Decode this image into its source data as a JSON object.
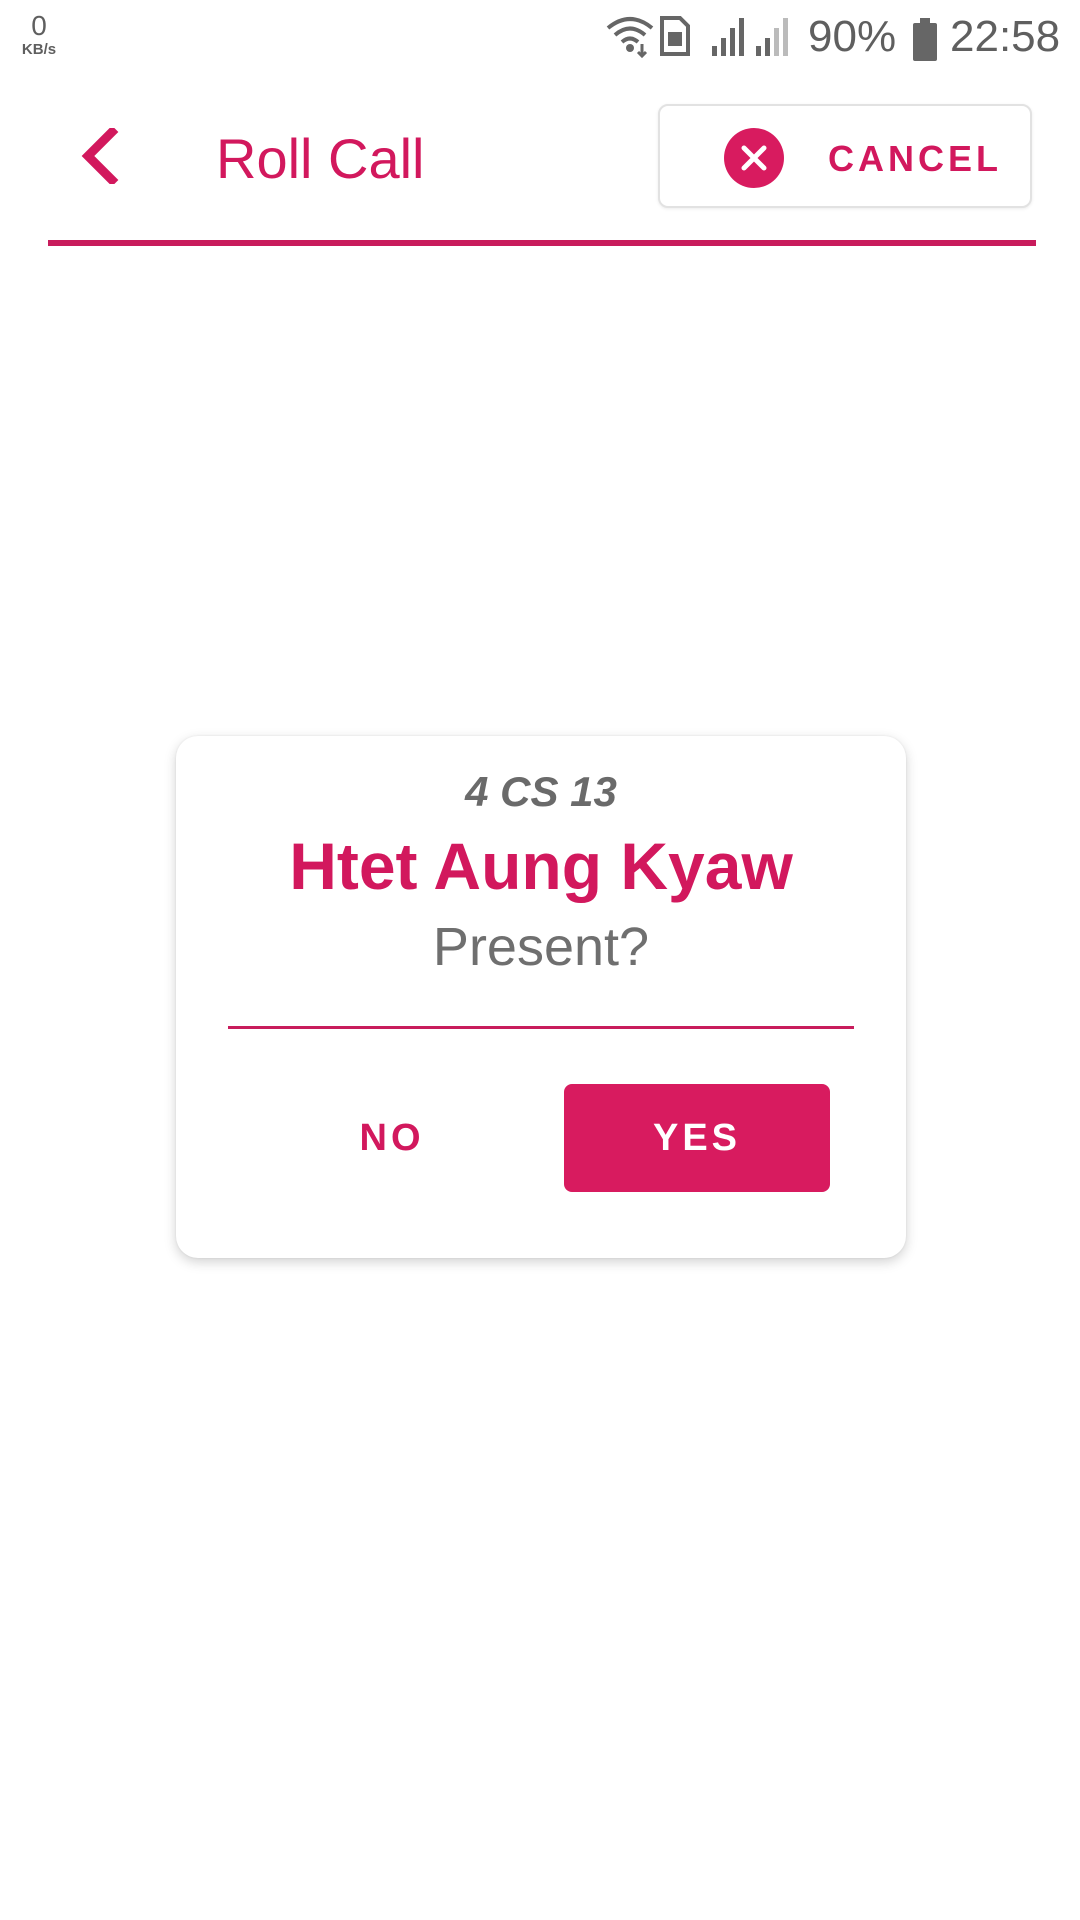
{
  "status_bar": {
    "net_speed_value": "0",
    "net_speed_unit": "KB/s",
    "battery_percent": "90%",
    "time": "22:58",
    "icons": [
      "wifi-icon",
      "sim-icon",
      "signal-icon",
      "signal-icon",
      "battery-icon"
    ]
  },
  "header": {
    "back_icon": "chevron-left-icon",
    "title": "Roll Call",
    "cancel_icon": "close-circle-icon",
    "cancel_label": "CANCEL"
  },
  "dialog": {
    "class_code": "4 CS 13",
    "student_name": "Htet Aung Kyaw",
    "question": "Present?",
    "no_label": "NO",
    "yes_label": "YES"
  },
  "colors": {
    "accent": "#d2185d",
    "yes_button": "#d81b5f",
    "muted_text": "#6f6f6f"
  }
}
